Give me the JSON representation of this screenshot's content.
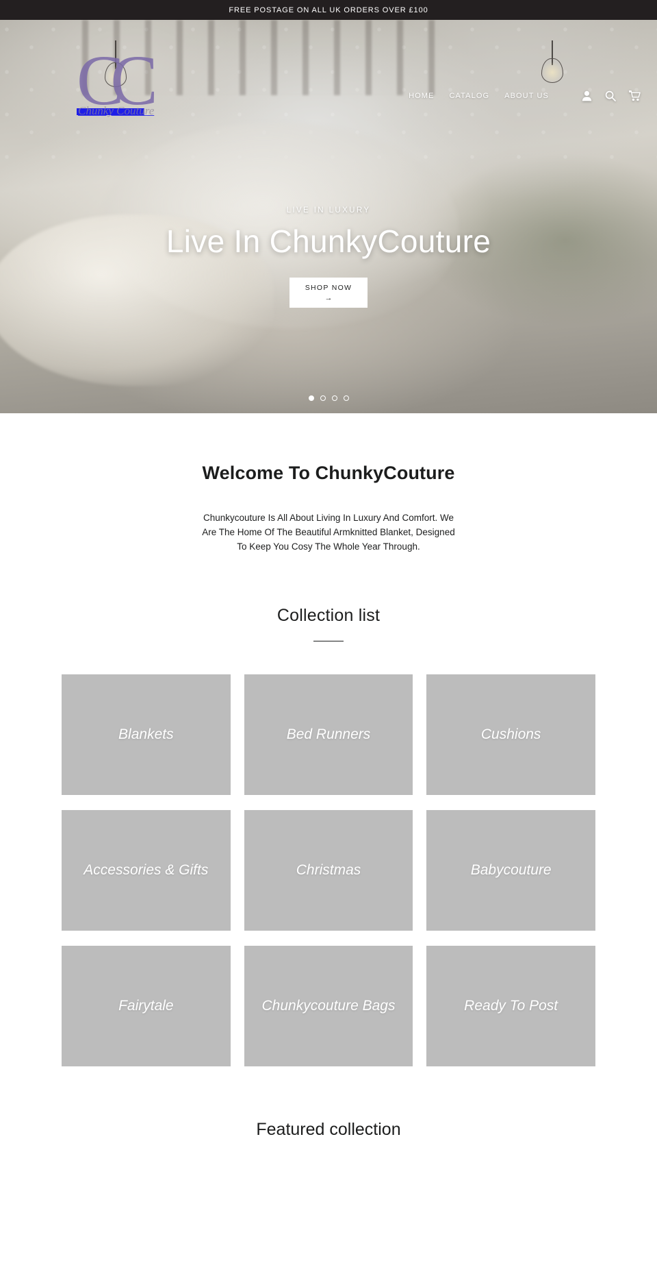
{
  "announcement": {
    "text": "FREE POSTAGE ON ALL UK ORDERS OVER £100"
  },
  "header": {
    "logo": {
      "monogram": "CC",
      "wordmark": "Chunky Couture"
    },
    "nav_items": [
      {
        "label": "HOME"
      },
      {
        "label": "CATALOG"
      },
      {
        "label": "ABOUT US"
      }
    ],
    "icons": [
      {
        "name": "account-icon",
        "title": "Account"
      },
      {
        "name": "search-icon",
        "title": "Search"
      },
      {
        "name": "cart-icon",
        "title": "Cart"
      }
    ]
  },
  "hero": {
    "eyebrow": "LIVE IN LUXURY",
    "heading": "Live In ChunkyCouture",
    "cta_label": "SHOP NOW",
    "cta_arrow": "→",
    "slides_total": 4,
    "active_slide": 1
  },
  "welcome": {
    "heading": "Welcome To ChunkyCouture",
    "body": "Chunkycouture Is All About Living In Luxury And Comfort. We Are The Home Of The Beautiful Armknitted Blanket, Designed To Keep You Cosy The Whole Year Through."
  },
  "collections": {
    "heading": "Collection list",
    "items": [
      {
        "title": "Blankets"
      },
      {
        "title": "Bed Runners"
      },
      {
        "title": "Cushions"
      },
      {
        "title": "Accessories & Gifts"
      },
      {
        "title": "Christmas"
      },
      {
        "title": "Babycouture"
      },
      {
        "title": "Fairytale"
      },
      {
        "title": "Chunkycouture Bags"
      },
      {
        "title": "Ready To Post"
      }
    ]
  },
  "featured": {
    "heading": "Featured collection"
  },
  "colors": {
    "announcement_bg": "#231f20",
    "text": "#1c1d1d",
    "logo_purple": "#7b6aa8",
    "collection_tile": "#bcbcbc"
  }
}
